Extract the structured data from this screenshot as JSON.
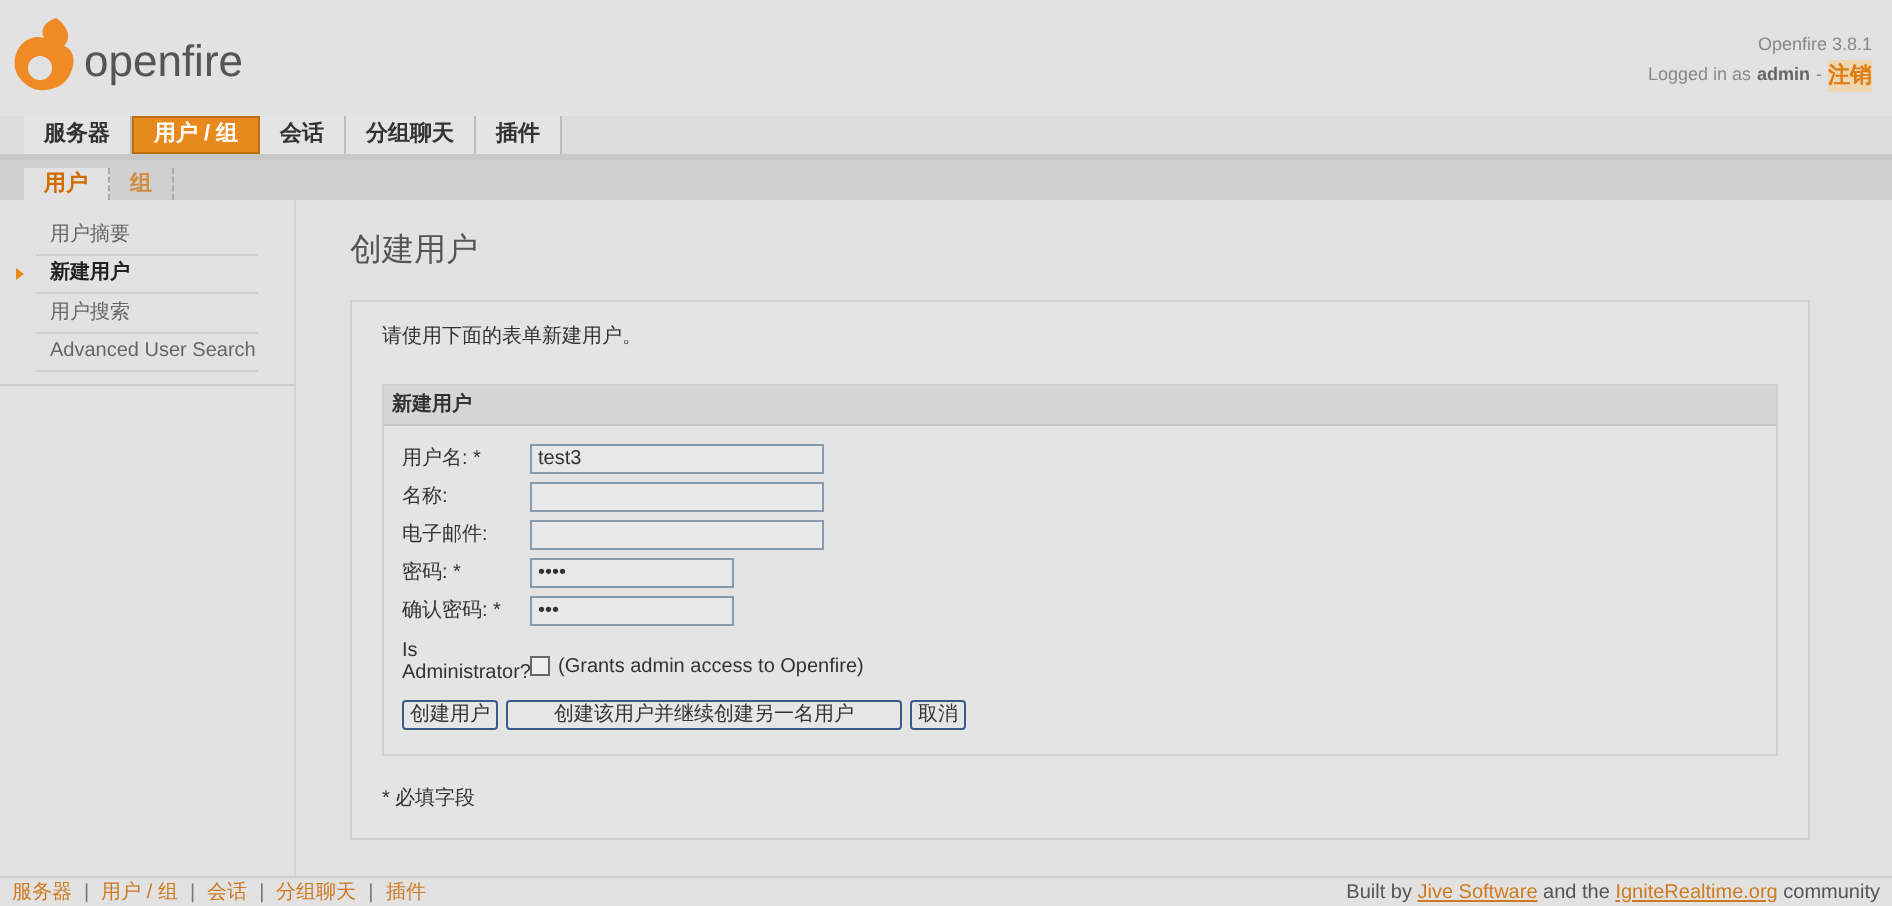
{
  "header": {
    "logo_text": "openfire",
    "version": "Openfire 3.8.1",
    "login_prefix": "Logged in as",
    "user": "admin",
    "separator": "-",
    "logout": "注销"
  },
  "nav_tabs": [
    {
      "label": "服务器",
      "selected": false
    },
    {
      "label": "用户 / 组",
      "selected": true
    },
    {
      "label": "会话",
      "selected": false
    },
    {
      "label": "分组聊天",
      "selected": false
    },
    {
      "label": "插件",
      "selected": false
    }
  ],
  "sub_tabs": [
    {
      "label": "用户",
      "selected": true
    },
    {
      "label": "组",
      "selected": false
    }
  ],
  "sidebar": {
    "items": [
      {
        "label": "用户摘要",
        "selected": false
      },
      {
        "label": "新建用户",
        "selected": true
      },
      {
        "label": "用户搜索",
        "selected": false
      },
      {
        "label": "Advanced User Search",
        "selected": false
      }
    ]
  },
  "page_title": "创建用户",
  "intro": "请使用下面的表单新建用户。",
  "form": {
    "title": "新建用户",
    "fields": [
      {
        "label": "用户名: *",
        "value": "test3",
        "kind": "text"
      },
      {
        "label": "名称:",
        "kind": "text"
      },
      {
        "label": "电子邮件:",
        "kind": "text"
      },
      {
        "label": "密码: *",
        "value": "••••",
        "kind": "password"
      },
      {
        "label": "确认密码: *",
        "value": "•••",
        "kind": "password"
      }
    ],
    "admin": {
      "label": "Is Administrator?",
      "checked": false,
      "hint": "(Grants admin access to Openfire)"
    },
    "buttons": [
      "创建用户",
      "创建该用户并继续创建另一名用户",
      "取消"
    ]
  },
  "required_note": "* 必填字段",
  "footer": {
    "separator": "|",
    "links": [
      "服务器",
      "用户 / 组",
      "会话",
      "分组聊天",
      "插件"
    ],
    "credit_prefix": "Built by",
    "credit_link_1": "Jive Software",
    "credit_middle": "and the",
    "credit_link_2": "IgniteRealtime.org",
    "credit_suffix": "community"
  }
}
